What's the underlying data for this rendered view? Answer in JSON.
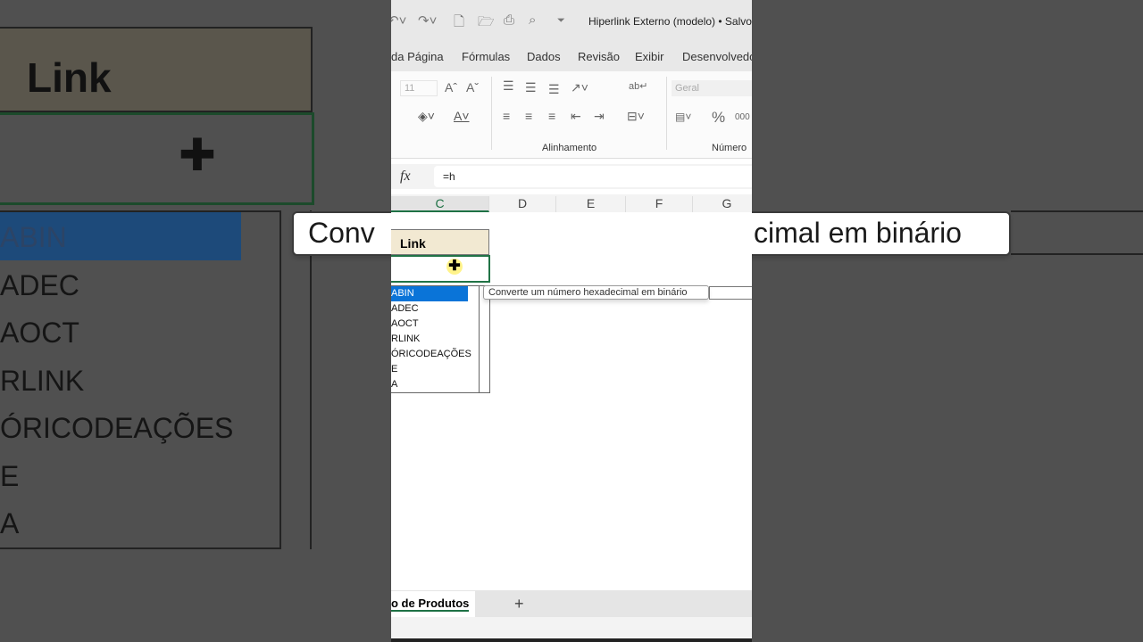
{
  "window": {
    "title": "Hiperlink Externo (modelo) • Salvo"
  },
  "ribbon_tabs": [
    "da Página",
    "Fórmulas",
    "Dados",
    "Revisão",
    "Exibir",
    "Desenvolvedo"
  ],
  "ribbon": {
    "font_size": "11",
    "number_format": "Geral",
    "group_alignment": "Alinhamento",
    "group_number": "Número",
    "percent": "%",
    "thousands": "000"
  },
  "formula_bar": {
    "fx": "fx",
    "value": "=h"
  },
  "columns": [
    "C",
    "D",
    "E",
    "F",
    "G"
  ],
  "sheet": {
    "header": "Link"
  },
  "autocomplete": {
    "items": [
      "ABIN",
      "ADEC",
      "AOCT",
      "RLINK",
      "ÓRICODEAÇÕES",
      "E",
      "A"
    ],
    "selected": 0
  },
  "tooltip": "Converte um número hexadecimal em binário",
  "background": {
    "header": "Link",
    "tooltip_left": "Conv",
    "tooltip_right": "cimal em binário"
  },
  "sheet_tabs": {
    "active": "o de Produtos",
    "add": "+"
  }
}
